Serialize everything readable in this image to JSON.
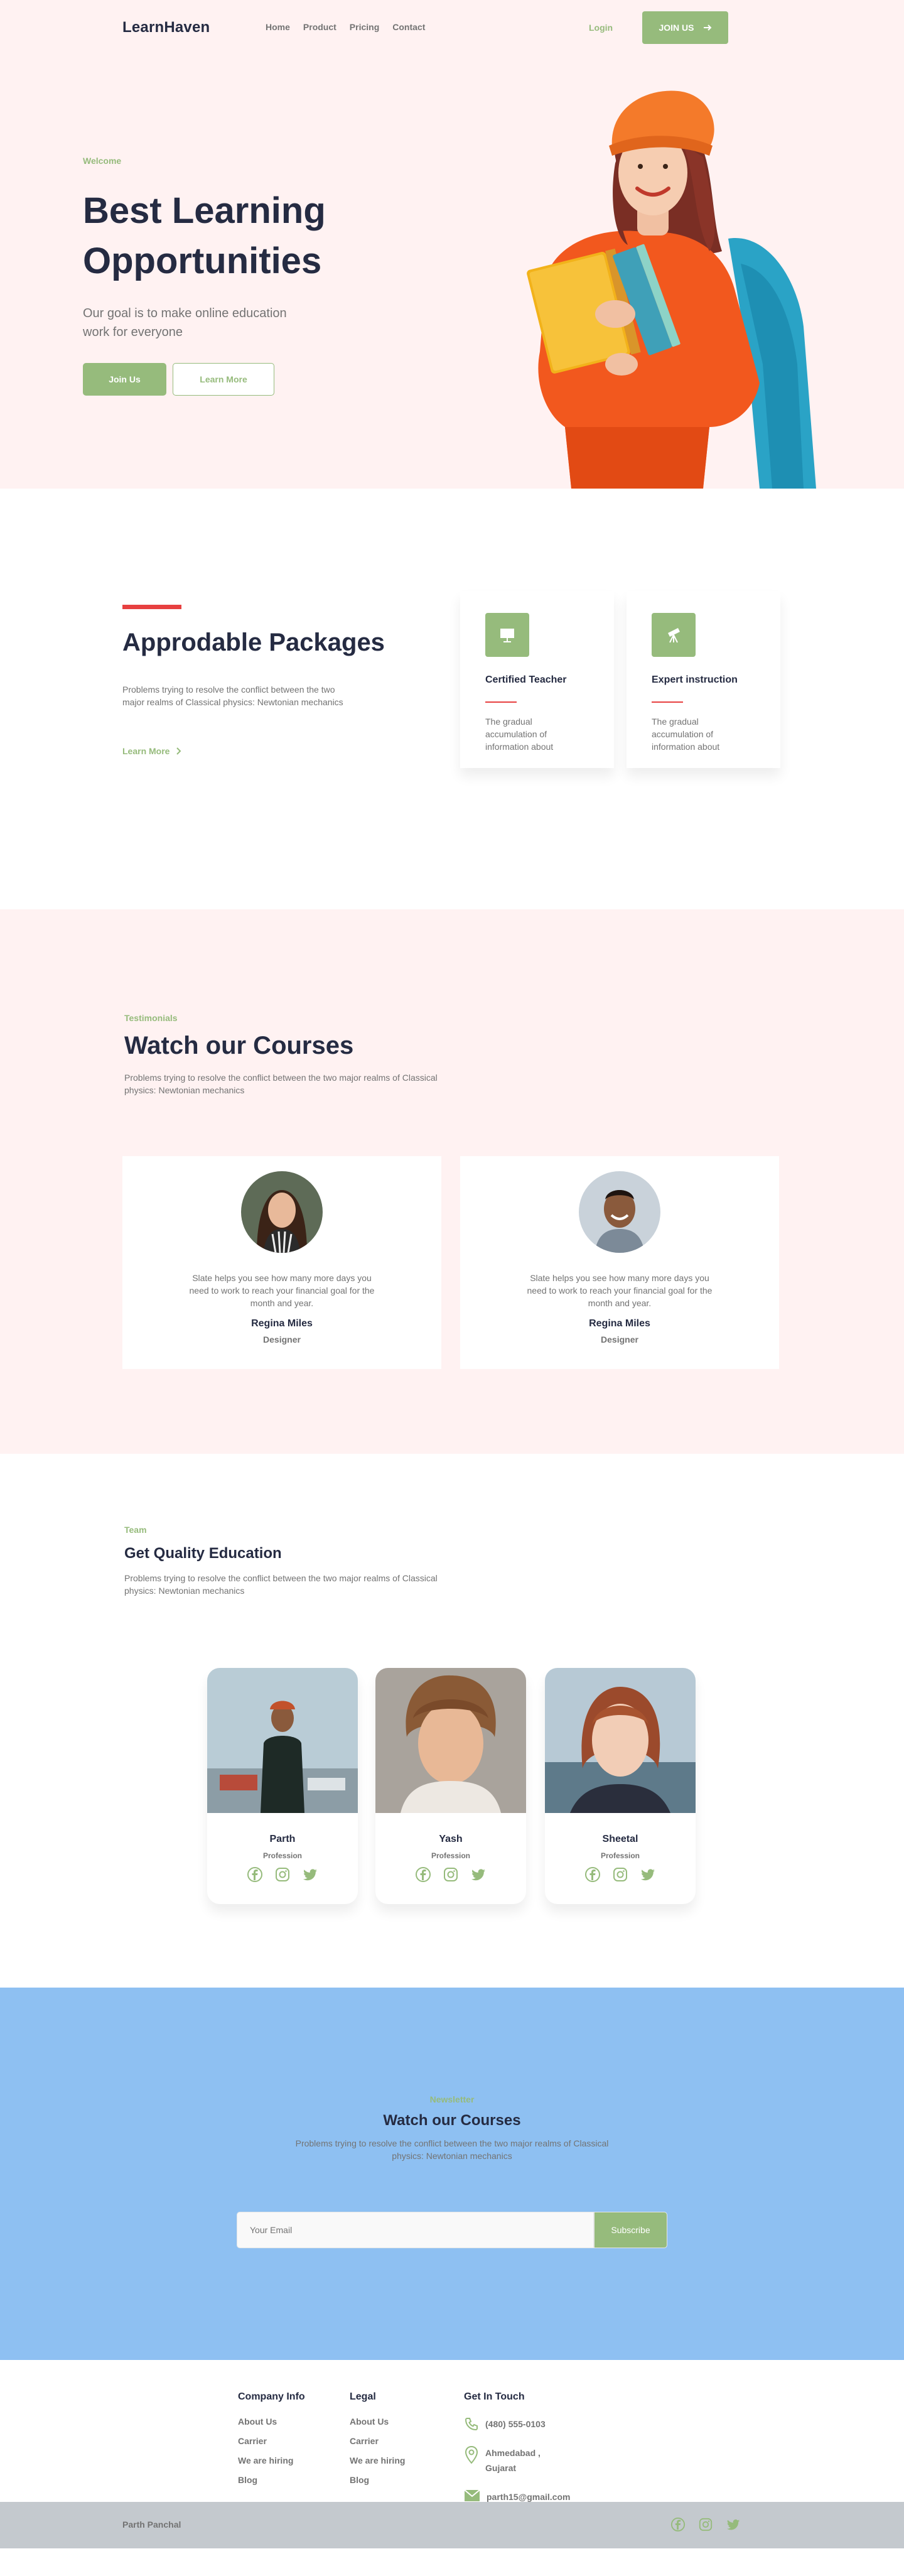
{
  "nav": {
    "logo": "LearnHaven",
    "links": [
      "Home",
      "Product",
      "Pricing",
      "Contact"
    ],
    "login": "Login",
    "join": "JOIN US"
  },
  "hero": {
    "eyebrow": "Welcome",
    "title": "Best Learning Opportunities",
    "subtitle": "Our goal is to make online education work for everyone",
    "primary_btn": "Join Us",
    "secondary_btn": "Learn More"
  },
  "packages": {
    "title": "Approdable Packages",
    "text": "Problems trying to resolve the conflict between the two major realms of Classical physics: Newtonian mechanics",
    "link": "Learn More",
    "features": [
      {
        "title": "Certified Teacher",
        "desc": "The gradual accumulation of information about",
        "icon": "presentation-board-icon"
      },
      {
        "title": "Expert instruction",
        "desc": "The gradual accumulation of information about",
        "icon": "telescope-icon"
      }
    ]
  },
  "testimonials": {
    "eyebrow": "Testimonials",
    "title": "Watch our Courses",
    "desc": "Problems trying to resolve the conflict between the two major realms of Classical physics: Newtonian mechanics",
    "cards": [
      {
        "quote": "Slate helps you see how many more days you need to work to reach your financial goal for the month and year.",
        "name": "Regina Miles",
        "role": "Designer"
      },
      {
        "quote": "Slate helps you see how many more days you need to work to reach your financial goal for the month and year.",
        "name": "Regina Miles",
        "role": "Designer"
      }
    ]
  },
  "team": {
    "eyebrow": "Team",
    "title": "Get Quality Education",
    "desc": "Problems trying to resolve the conflict between the two major realms of Classical physics: Newtonian mechanics",
    "members": [
      {
        "name": "Parth",
        "role": "Profession"
      },
      {
        "name": "Yash",
        "role": "Profession"
      },
      {
        "name": "Sheetal",
        "role": "Profession"
      }
    ]
  },
  "subscribe": {
    "eyebrow": "Newsletter",
    "title": "Watch our Courses",
    "desc": "Problems trying to resolve the conflict between the two major realms of Classical physics: Newtonian mechanics",
    "placeholder": "Your Email",
    "button": "Subscribe"
  },
  "footer": {
    "company": {
      "heading": "Company Info",
      "items": [
        "About Us",
        "Carrier",
        "We are hiring",
        "Blog"
      ]
    },
    "legal": {
      "heading": "Legal",
      "items": [
        "About Us",
        "Carrier",
        "We are hiring",
        "Blog"
      ]
    },
    "contact": {
      "heading": "Get In Touch",
      "phone": "(480) 555-0103",
      "address": "Ahmedabad , Gujarat",
      "email": "parth15@gmail.com"
    },
    "copyright": "Parth Panchal"
  },
  "colors": {
    "primary": "#96BB7C",
    "dark": "#252B42",
    "muted": "#737373",
    "accent_red": "#E74040",
    "hero_bg": "#FFF2F2",
    "subscribe_bg": "#8EC0F2"
  }
}
